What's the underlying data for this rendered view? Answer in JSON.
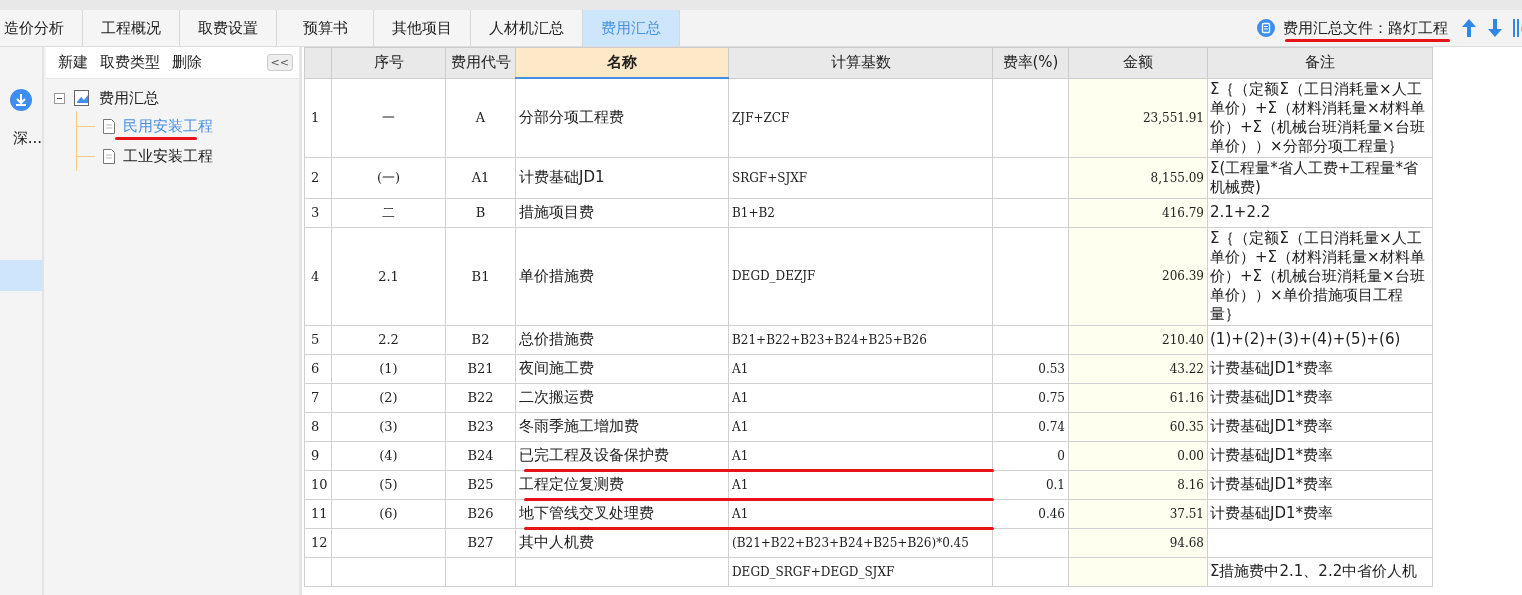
{
  "tabs": [
    {
      "label": "造价分析",
      "selected": false
    },
    {
      "label": "工程概况",
      "selected": false
    },
    {
      "label": "取费设置",
      "selected": false
    },
    {
      "label": "预算书",
      "selected": false
    },
    {
      "label": "其他项目",
      "selected": false
    },
    {
      "label": "人材机汇总",
      "selected": false
    },
    {
      "label": "费用汇总",
      "selected": true
    }
  ],
  "file_label": {
    "text": "费用汇总文件：路灯工程",
    "marked": true
  },
  "left_rail": {
    "items": [
      {
        "label": "深...",
        "selected": false
      },
      {
        "selected": true
      }
    ]
  },
  "toolbar": [
    "新建",
    "取费类型",
    "删除"
  ],
  "collapse_button": "<<",
  "tree": {
    "label": "费用汇总",
    "expanded": true,
    "children": [
      {
        "label": "民用安装工程",
        "selected": true,
        "marked": true
      },
      {
        "label": "工业安装工程",
        "selected": false,
        "marked": false
      }
    ]
  },
  "table": {
    "columns": [
      "序号",
      "费用代号",
      "名称",
      "计算基数",
      "费率(%)",
      "金额",
      "备注"
    ],
    "rows": [
      {
        "row_number": "1",
        "seq": "一",
        "code": "A",
        "name": "分部分项工程费",
        "basis": "ZJF+ZCF",
        "amount": "23,551.91",
        "remark": "Σ｛（定额Σ（工日消耗量×人工单价）+Σ（材料消耗量×材料单价）+Σ（机械台班消耗量×台班单价））×分部分项工程量｝",
        "marked": false
      },
      {
        "row_number": "2",
        "seq": "(一)",
        "code": "A1",
        "name": "计费基础JD1",
        "basis": "SRGF+SJXF",
        "amount": "8,155.09",
        "remark": "Σ(工程量*省人工费+工程量*省机械费)",
        "marked": false
      },
      {
        "row_number": "3",
        "seq": "二",
        "code": "B",
        "name": "措施项目费",
        "basis": "B1+B2",
        "amount": "416.79",
        "remark": "2.1+2.2",
        "marked": false
      },
      {
        "row_number": "4",
        "seq": "2.1",
        "code": "B1",
        "name": "单价措施费",
        "basis": "DEGD_DEZJF",
        "amount": "206.39",
        "remark": "Σ｛（定额Σ（工日消耗量×人工单价）+Σ（材料消耗量×材料单价）+Σ（机械台班消耗量×台班单价））×单价措施项目工程量｝",
        "marked": false
      },
      {
        "row_number": "5",
        "seq": "2.2",
        "code": "B2",
        "name": "总价措施费",
        "basis": "B21+B22+B23+B24+B25+B26",
        "amount": "210.40",
        "remark": "(1)+(2)+(3)+(4)+(5)+(6)",
        "marked": false
      },
      {
        "row_number": "6",
        "seq": "(1)",
        "code": "B21",
        "name": "夜间施工费",
        "basis": "A1",
        "rate": "0.53",
        "amount": "43.22",
        "remark": "计费基础JD1*费率",
        "marked": false
      },
      {
        "row_number": "7",
        "seq": "(2)",
        "code": "B22",
        "name": "二次搬运费",
        "basis": "A1",
        "rate": "0.75",
        "amount": "61.16",
        "remark": "计费基础JD1*费率",
        "marked": false
      },
      {
        "row_number": "8",
        "seq": "(3)",
        "code": "B23",
        "name": "冬雨季施工增加费",
        "basis": "A1",
        "rate": "0.74",
        "amount": "60.35",
        "remark": "计费基础JD1*费率",
        "marked": false
      },
      {
        "row_number": "9",
        "seq": "(4)",
        "code": "B24",
        "name": "已完工程及设备保护费",
        "basis": "A1",
        "rate": "0",
        "amount": "0.00",
        "remark": "计费基础JD1*费率",
        "marked": true
      },
      {
        "row_number": "10",
        "seq": "(5)",
        "code": "B25",
        "name": "工程定位复测费",
        "basis": "A1",
        "rate": "0.1",
        "amount": "8.16",
        "remark": "计费基础JD1*费率",
        "marked": true
      },
      {
        "row_number": "11",
        "seq": "(6)",
        "code": "B26",
        "name": "地下管线交叉处理费",
        "basis": "A1",
        "rate": "0.46",
        "amount": "37.51",
        "remark": "计费基础JD1*费率",
        "marked": true
      },
      {
        "row_number": "12",
        "code": "B27",
        "name": "其中人机费",
        "basis": "(B21+B22+B23+B24+B25+B26)*0.45",
        "amount": "94.68",
        "marked": false
      },
      {
        "basis": "DEGD_SRGF+DEGD_SJXF",
        "remark": "Σ措施费中2.1、2.2中省价人机",
        "marked": false
      }
    ]
  }
}
